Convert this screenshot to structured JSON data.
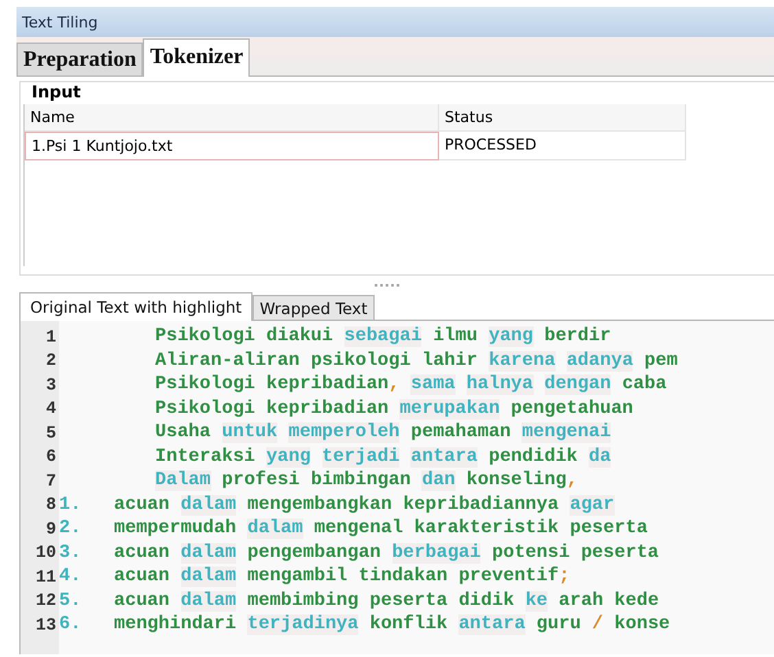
{
  "window": {
    "title": "Text Tiling"
  },
  "tabs": [
    {
      "label": "Preparation",
      "selected": false
    },
    {
      "label": "Tokenizer",
      "selected": true
    }
  ],
  "input": {
    "title": "Input",
    "columns": [
      "Name",
      "Status"
    ],
    "rows": [
      {
        "cells": [
          "1.Psi 1 Kuntjojo.txt",
          "PROCESSED"
        ],
        "selected": true
      }
    ]
  },
  "text_tabs": [
    {
      "label": "Original Text with highlight",
      "selected": true
    },
    {
      "label": "Wrapped Text",
      "selected": false
    }
  ],
  "lines": [
    {
      "number": "1",
      "tokens": [
        {
          "text": "Psikologi",
          "kind": "word"
        },
        {
          "text": "diakui",
          "kind": "word"
        },
        {
          "text": "sebagai",
          "kind": "stop"
        },
        {
          "text": "ilmu",
          "kind": "word"
        },
        {
          "text": "yang",
          "kind": "stop"
        },
        {
          "text": "berdir",
          "kind": "word"
        }
      ]
    },
    {
      "number": "2",
      "tokens": [
        {
          "text": "Aliran-aliran",
          "kind": "word"
        },
        {
          "text": "psikologi",
          "kind": "word"
        },
        {
          "text": "lahir",
          "kind": "word"
        },
        {
          "text": "karena",
          "kind": "stop"
        },
        {
          "text": "adanya",
          "kind": "stop"
        },
        {
          "text": "pem",
          "kind": "word"
        }
      ]
    },
    {
      "number": "3",
      "tokens": [
        {
          "text": "Psikologi",
          "kind": "word"
        },
        {
          "text": "kepribadian",
          "kind": "word"
        },
        {
          "text": ",",
          "kind": "punct",
          "glue": true
        },
        {
          "text": "sama",
          "kind": "stop"
        },
        {
          "text": "halnya",
          "kind": "stop"
        },
        {
          "text": "dengan",
          "kind": "stop"
        },
        {
          "text": "caba",
          "kind": "word"
        }
      ]
    },
    {
      "number": "4",
      "tokens": [
        {
          "text": "Psikologi",
          "kind": "word"
        },
        {
          "text": "kepribadian",
          "kind": "word"
        },
        {
          "text": "merupakan",
          "kind": "stop"
        },
        {
          "text": "pengetahuan",
          "kind": "word"
        }
      ]
    },
    {
      "number": "5",
      "tokens": [
        {
          "text": "Usaha",
          "kind": "word"
        },
        {
          "text": "untuk",
          "kind": "stop"
        },
        {
          "text": "memperoleh",
          "kind": "stop"
        },
        {
          "text": "pemahaman",
          "kind": "word"
        },
        {
          "text": "mengenai",
          "kind": "stop"
        }
      ]
    },
    {
      "number": "6",
      "tokens": [
        {
          "text": "Interaksi",
          "kind": "word"
        },
        {
          "text": "yang",
          "kind": "stop"
        },
        {
          "text": "terjadi",
          "kind": "stop"
        },
        {
          "text": "antara",
          "kind": "stop"
        },
        {
          "text": "pendidik",
          "kind": "word"
        },
        {
          "text": "da",
          "kind": "stop"
        }
      ]
    },
    {
      "number": "7",
      "tokens": [
        {
          "text": "Dalam",
          "kind": "stop"
        },
        {
          "text": "profesi",
          "kind": "word"
        },
        {
          "text": "bimbingan",
          "kind": "word"
        },
        {
          "text": "dan",
          "kind": "stop"
        },
        {
          "text": "konseling",
          "kind": "word"
        },
        {
          "text": ",",
          "kind": "punct",
          "glue": true
        }
      ]
    },
    {
      "number": "8",
      "marker": "1.",
      "tokens": [
        {
          "text": "acuan",
          "kind": "word"
        },
        {
          "text": "dalam",
          "kind": "stop"
        },
        {
          "text": "mengembangkan",
          "kind": "word"
        },
        {
          "text": "kepribadiannya",
          "kind": "word"
        },
        {
          "text": "agar",
          "kind": "stop"
        }
      ]
    },
    {
      "number": "9",
      "marker": "2.",
      "tokens": [
        {
          "text": "mempermudah",
          "kind": "word"
        },
        {
          "text": "dalam",
          "kind": "stop"
        },
        {
          "text": "mengenal",
          "kind": "word"
        },
        {
          "text": "karakteristik",
          "kind": "word"
        },
        {
          "text": "peserta",
          "kind": "word"
        }
      ]
    },
    {
      "number": "10",
      "marker": "3.",
      "tokens": [
        {
          "text": "acuan",
          "kind": "word"
        },
        {
          "text": "dalam",
          "kind": "stop"
        },
        {
          "text": "pengembangan",
          "kind": "word"
        },
        {
          "text": "berbagai",
          "kind": "stop"
        },
        {
          "text": "potensi",
          "kind": "word"
        },
        {
          "text": "peserta",
          "kind": "word"
        }
      ]
    },
    {
      "number": "11",
      "marker": "4.",
      "tokens": [
        {
          "text": "acuan",
          "kind": "word"
        },
        {
          "text": "dalam",
          "kind": "stop"
        },
        {
          "text": "mengambil",
          "kind": "word"
        },
        {
          "text": "tindakan",
          "kind": "word"
        },
        {
          "text": "preventif",
          "kind": "word"
        },
        {
          "text": ";",
          "kind": "punct",
          "glue": true
        }
      ]
    },
    {
      "number": "12",
      "marker": "5.",
      "tokens": [
        {
          "text": "acuan",
          "kind": "word"
        },
        {
          "text": "dalam",
          "kind": "stop"
        },
        {
          "text": "membimbing",
          "kind": "word"
        },
        {
          "text": "peserta",
          "kind": "word"
        },
        {
          "text": "didik",
          "kind": "word"
        },
        {
          "text": "ke",
          "kind": "stop"
        },
        {
          "text": "arah",
          "kind": "word"
        },
        {
          "text": "kede",
          "kind": "word"
        }
      ]
    },
    {
      "number": "13",
      "marker": "6.",
      "tokens": [
        {
          "text": "menghindari",
          "kind": "word"
        },
        {
          "text": "terjadinya",
          "kind": "stop"
        },
        {
          "text": "konflik",
          "kind": "word"
        },
        {
          "text": "antara",
          "kind": "stop"
        },
        {
          "text": "guru",
          "kind": "word"
        },
        {
          "text": "/",
          "kind": "punct"
        },
        {
          "text": "konse",
          "kind": "word"
        }
      ]
    }
  ]
}
